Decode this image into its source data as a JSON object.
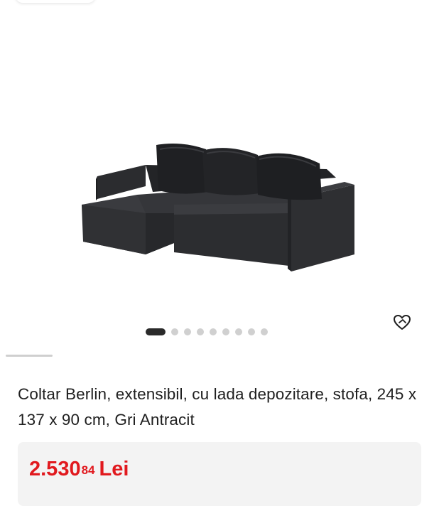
{
  "gallery": {
    "image_alt": "Coltar Berlin, canapea extensibila gri antracit",
    "dots": [
      {
        "active": true
      },
      {
        "active": false
      },
      {
        "active": false
      },
      {
        "active": false
      },
      {
        "active": false
      },
      {
        "active": false
      },
      {
        "active": false
      },
      {
        "active": false
      },
      {
        "active": false
      }
    ],
    "wishlist_icon": "heart-outline-icon"
  },
  "product": {
    "title": "Coltar Berlin, extensibil, cu lada depozitare, stofa, 245 x 137 x 90 cm, Gri Antracit",
    "price": {
      "integer": "2.530",
      "decimals": "84",
      "currency": "Lei"
    }
  },
  "colors": {
    "price": "#e1191e",
    "price_bg": "#f3f3f3",
    "dot_active": "#2a2a2a",
    "dot_inactive": "#d0d0d0"
  }
}
